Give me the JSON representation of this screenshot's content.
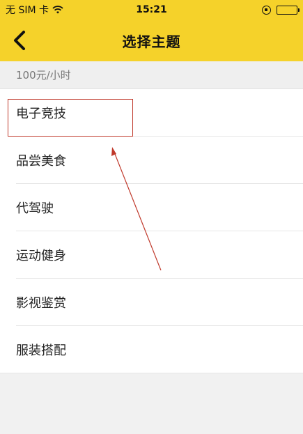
{
  "status_bar": {
    "carrier": "无 SIM 卡",
    "wifi_icon": "wifi-icon",
    "time": "15:21",
    "rotation_lock_icon": "rotation-lock-icon",
    "battery_icon": "battery-icon"
  },
  "nav": {
    "back_icon": "chevron-left-icon",
    "title": "选择主题"
  },
  "section": {
    "price_label": "100元/小时"
  },
  "topics": {
    "items": [
      {
        "label": "电子竞技",
        "highlighted": true
      },
      {
        "label": "品尝美食"
      },
      {
        "label": "代驾驶"
      },
      {
        "label": "运动健身"
      },
      {
        "label": "影视鉴赏"
      },
      {
        "label": "服装搭配"
      }
    ]
  },
  "colors": {
    "header_yellow": "#f5d22a",
    "annotation_red": "#c0392b",
    "background": "#f1f1f1"
  }
}
